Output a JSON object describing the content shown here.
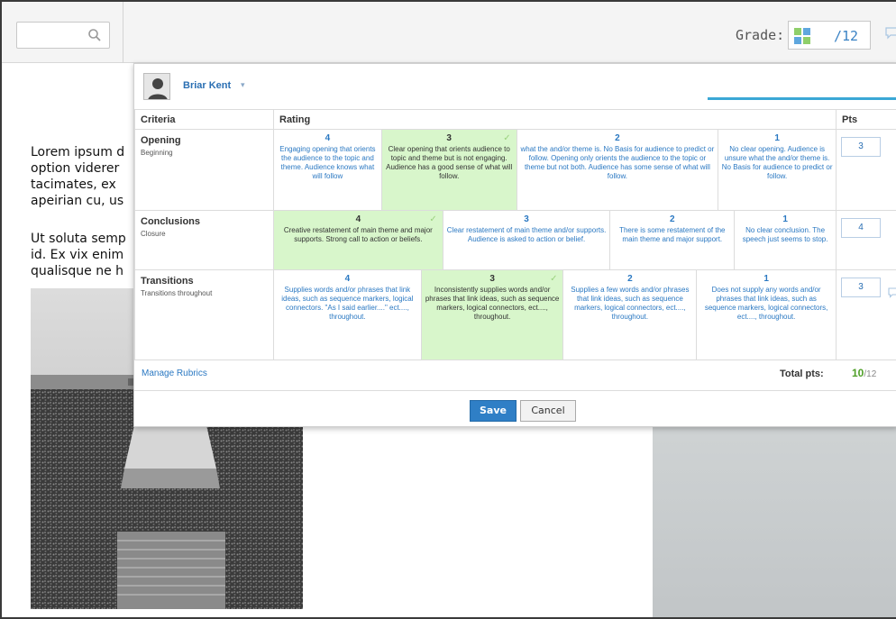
{
  "topbar": {
    "search": {
      "placeholder": "",
      "icon": "search-icon"
    },
    "grade_label": "Grade:",
    "grade_max": "/12"
  },
  "background": {
    "para1": [
      "Lorem ipsum d",
      "option viderer",
      "tacimates, ex",
      "apeirian cu, us"
    ],
    "para2": [
      "Ut soluta semp",
      "id. Ex vix enim",
      "qualisque ne h"
    ]
  },
  "student": {
    "name": "Briar Kent",
    "caret": "▾"
  },
  "rubric": {
    "headers": {
      "criteria": "Criteria",
      "rating": "Rating",
      "pts": "Pts"
    },
    "criteria": [
      {
        "title": "Opening",
        "subtitle": "Beginning",
        "pts": "3",
        "ratings": [
          {
            "points": "4",
            "desc": "Engaging opening that orients the audience to the topic and theme. Audience knows what will follow",
            "selected": false
          },
          {
            "points": "3",
            "desc": "Clear opening that orients audience to topic and theme but is not engaging. Audience has a good sense of what will follow.",
            "selected": true
          },
          {
            "points": "2",
            "desc": "what the and/or theme is. No Basis for audience to predict or follow. Opening only orients the audience to the topic or theme but not both. Audience has some sense of what will follow.",
            "selected": false
          },
          {
            "points": "1",
            "desc": "No clear opening. Audience is unsure what the and/or theme is. No Basis for audience to predict or follow.",
            "selected": false
          }
        ]
      },
      {
        "title": "Conclusions",
        "subtitle": "Closure",
        "pts": "4",
        "ratings": [
          {
            "points": "4",
            "desc": "Creative restatement of main theme and major supports. Strong call to action or beliefs.",
            "selected": true
          },
          {
            "points": "3",
            "desc": "Clear restatement of main theme and/or supports. Audience is asked to action or belief.",
            "selected": false
          },
          {
            "points": "2",
            "desc": "There is some restatement of the main theme and major support.",
            "selected": false
          },
          {
            "points": "1",
            "desc": "No clear conclusion. The speech just seems to stop.",
            "selected": false
          }
        ]
      },
      {
        "title": "Transitions",
        "subtitle": "Transitions throughout",
        "pts": "3",
        "ratings": [
          {
            "points": "4",
            "desc": "Supplies words and/or phrases that link ideas, such as sequence markers, logical connectors. \"As I said earlier....\" ect...., throughout.",
            "selected": false
          },
          {
            "points": "3",
            "desc": "Inconsistently supplies words and/or phrases that link ideas, such as sequence markers, logical connectors, ect...., throughout.",
            "selected": true
          },
          {
            "points": "2",
            "desc": "Supplies a few words and/or phrases that link ideas, such as sequence markers, logical connectors, ect...., throughout.",
            "selected": false
          },
          {
            "points": "1",
            "desc": "Does not supply any words and/or phrases that link ideas, such as sequence markers, logical connectors, ect...., throughout.",
            "selected": false
          }
        ]
      }
    ],
    "manage_link": "Manage Rubrics",
    "total_label": "Total pts:",
    "total_score": "10",
    "total_max": "/12"
  },
  "buttons": {
    "save": "Save",
    "cancel": "Cancel"
  },
  "colors": {
    "accent": "#2f7fc6",
    "selected_bg": "#d8f6cb",
    "link": "#2a78c2",
    "score_green": "#4f9f27"
  }
}
